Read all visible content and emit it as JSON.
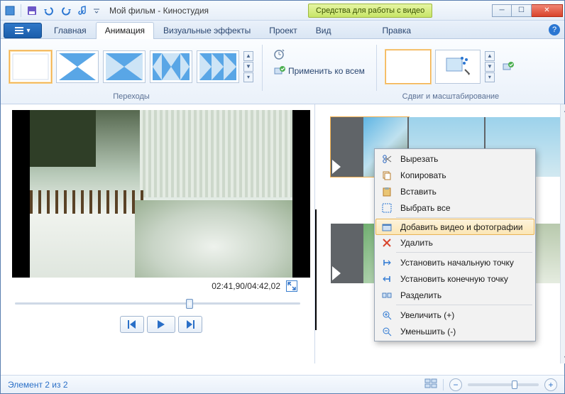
{
  "titlebar": {
    "app_title": "Мой фильм - Киностудия",
    "tool_tab": "Средства для работы с видео"
  },
  "tabs": {
    "home": "Главная",
    "animation": "Анимация",
    "effects": "Визуальные эффекты",
    "project": "Проект",
    "view": "Вид",
    "edit": "Правка"
  },
  "ribbon": {
    "transitions_label": "Переходы",
    "apply_all": "Применить ко всем",
    "panzoom_label": "Сдвиг и масштабирование"
  },
  "preview": {
    "time": "02:41,90/04:42,02",
    "slider_pos_pct": 60
  },
  "context_menu": {
    "cut": "Вырезать",
    "copy": "Копировать",
    "paste": "Вставить",
    "select_all": "Выбрать все",
    "add_media": "Добавить видео и фотографии",
    "delete": "Удалить",
    "set_start": "Установить начальную точку",
    "set_end": "Установить конечную точку",
    "split": "Разделить",
    "zoom_in": "Увеличить (+)",
    "zoom_out": "Уменьшить (-)"
  },
  "statusbar": {
    "item_count": "Элемент 2 из 2",
    "zoom_thumb_pct": 62
  }
}
